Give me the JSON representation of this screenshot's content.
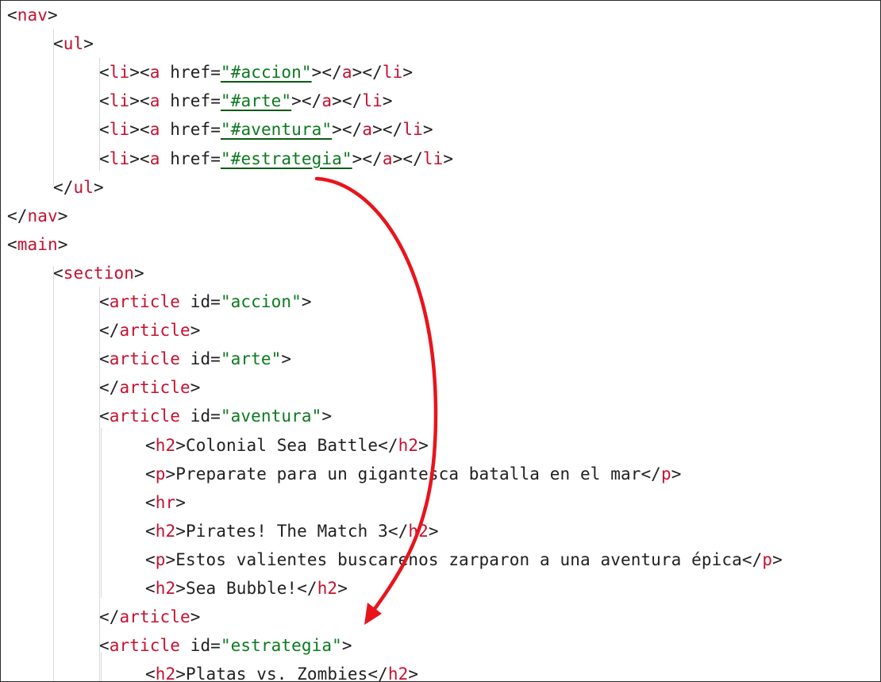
{
  "code": {
    "language": "html",
    "lines": [
      {
        "indent": 0,
        "parts": [
          [
            "p",
            "<"
          ],
          [
            "t",
            "nav"
          ],
          [
            "p",
            ">"
          ]
        ]
      },
      {
        "indent": 1,
        "parts": [
          [
            "p",
            "<"
          ],
          [
            "t",
            "ul"
          ],
          [
            "p",
            ">"
          ]
        ]
      },
      {
        "indent": 2,
        "parts": [
          [
            "p",
            "<"
          ],
          [
            "t",
            "li"
          ],
          [
            "p",
            "><"
          ],
          [
            "t",
            "a"
          ],
          [
            "a",
            " href="
          ],
          [
            "v",
            "\"#accion\"",
            "u"
          ],
          [
            "p",
            "></"
          ],
          [
            "t",
            "a"
          ],
          [
            "p",
            "></"
          ],
          [
            "t",
            "li"
          ],
          [
            "p",
            ">"
          ]
        ]
      },
      {
        "indent": 2,
        "parts": [
          [
            "p",
            "<"
          ],
          [
            "t",
            "li"
          ],
          [
            "p",
            "><"
          ],
          [
            "t",
            "a"
          ],
          [
            "a",
            " href="
          ],
          [
            "v",
            "\"#arte\"",
            "u"
          ],
          [
            "p",
            "></"
          ],
          [
            "t",
            "a"
          ],
          [
            "p",
            "></"
          ],
          [
            "t",
            "li"
          ],
          [
            "p",
            ">"
          ]
        ]
      },
      {
        "indent": 2,
        "parts": [
          [
            "p",
            "<"
          ],
          [
            "t",
            "li"
          ],
          [
            "p",
            "><"
          ],
          [
            "t",
            "a"
          ],
          [
            "a",
            " href="
          ],
          [
            "v",
            "\"#aventura\"",
            "u"
          ],
          [
            "p",
            "></"
          ],
          [
            "t",
            "a"
          ],
          [
            "p",
            "></"
          ],
          [
            "t",
            "li"
          ],
          [
            "p",
            ">"
          ]
        ]
      },
      {
        "indent": 2,
        "parts": [
          [
            "p",
            "<"
          ],
          [
            "t",
            "li"
          ],
          [
            "p",
            "><"
          ],
          [
            "t",
            "a"
          ],
          [
            "a",
            " href="
          ],
          [
            "v",
            "\"#estrategia\"",
            "u"
          ],
          [
            "p",
            "></"
          ],
          [
            "t",
            "a"
          ],
          [
            "p",
            "></"
          ],
          [
            "t",
            "li"
          ],
          [
            "p",
            ">"
          ]
        ]
      },
      {
        "indent": 1,
        "parts": [
          [
            "p",
            "</"
          ],
          [
            "t",
            "ul"
          ],
          [
            "p",
            ">"
          ]
        ]
      },
      {
        "indent": 0,
        "parts": [
          [
            "p",
            "</"
          ],
          [
            "t",
            "nav"
          ],
          [
            "p",
            ">"
          ]
        ]
      },
      {
        "indent": 0,
        "parts": [
          [
            "p",
            "<"
          ],
          [
            "t",
            "main"
          ],
          [
            "p",
            ">"
          ]
        ]
      },
      {
        "indent": 1,
        "parts": [
          [
            "p",
            "<"
          ],
          [
            "t",
            "section"
          ],
          [
            "p",
            ">"
          ]
        ]
      },
      {
        "indent": 2,
        "parts": [
          [
            "p",
            "<"
          ],
          [
            "t",
            "article"
          ],
          [
            "a",
            " id="
          ],
          [
            "v",
            "\"accion\""
          ],
          [
            "p",
            ">"
          ]
        ]
      },
      {
        "indent": 2,
        "parts": [
          [
            "p",
            "</"
          ],
          [
            "t",
            "article"
          ],
          [
            "p",
            ">"
          ]
        ]
      },
      {
        "indent": 2,
        "parts": [
          [
            "p",
            "<"
          ],
          [
            "t",
            "article"
          ],
          [
            "a",
            " id="
          ],
          [
            "v",
            "\"arte\""
          ],
          [
            "p",
            ">"
          ]
        ]
      },
      {
        "indent": 2,
        "parts": [
          [
            "p",
            "</"
          ],
          [
            "t",
            "article"
          ],
          [
            "p",
            ">"
          ]
        ]
      },
      {
        "indent": 2,
        "parts": [
          [
            "p",
            "<"
          ],
          [
            "t",
            "article"
          ],
          [
            "a",
            " id="
          ],
          [
            "v",
            "\"aventura\""
          ],
          [
            "p",
            ">"
          ]
        ]
      },
      {
        "indent": 3,
        "parts": [
          [
            "p",
            "<"
          ],
          [
            "t",
            "h2"
          ],
          [
            "p",
            ">"
          ],
          [
            "x",
            "Colonial Sea Battle"
          ],
          [
            "p",
            "</"
          ],
          [
            "t",
            "h2"
          ],
          [
            "p",
            ">"
          ]
        ]
      },
      {
        "indent": 3,
        "parts": [
          [
            "p",
            "<"
          ],
          [
            "t",
            "p"
          ],
          [
            "p",
            ">"
          ],
          [
            "x",
            "Preparate para un gigantesca batalla en el mar"
          ],
          [
            "p",
            "</"
          ],
          [
            "t",
            "p"
          ],
          [
            "p",
            ">"
          ]
        ]
      },
      {
        "indent": 3,
        "parts": [
          [
            "p",
            "<"
          ],
          [
            "t",
            "hr"
          ],
          [
            "p",
            ">"
          ]
        ]
      },
      {
        "indent": 3,
        "parts": [
          [
            "p",
            "<"
          ],
          [
            "t",
            "h2"
          ],
          [
            "p",
            ">"
          ],
          [
            "x",
            "Pirates! The Match 3"
          ],
          [
            "p",
            "</"
          ],
          [
            "t",
            "h2"
          ],
          [
            "p",
            ">"
          ]
        ]
      },
      {
        "indent": 3,
        "parts": [
          [
            "p",
            "<"
          ],
          [
            "t",
            "p"
          ],
          [
            "p",
            ">"
          ],
          [
            "x",
            "Estos valientes buscarenos zarparon a una aventura épica"
          ],
          [
            "p",
            "</"
          ],
          [
            "t",
            "p"
          ],
          [
            "p",
            ">"
          ]
        ]
      },
      {
        "indent": 3,
        "parts": [
          [
            "p",
            "<"
          ],
          [
            "t",
            "h2"
          ],
          [
            "p",
            ">"
          ],
          [
            "x",
            "Sea Bubble!"
          ],
          [
            "p",
            "</"
          ],
          [
            "t",
            "h2"
          ],
          [
            "p",
            ">"
          ]
        ]
      },
      {
        "indent": 2,
        "parts": [
          [
            "p",
            "</"
          ],
          [
            "t",
            "article"
          ],
          [
            "p",
            ">"
          ]
        ]
      },
      {
        "indent": 2,
        "parts": [
          [
            "p",
            "<"
          ],
          [
            "t",
            "article"
          ],
          [
            "a",
            " id="
          ],
          [
            "v",
            "\"estrategia\""
          ],
          [
            "p",
            ">"
          ]
        ]
      },
      {
        "indent": 3,
        "parts": [
          [
            "p",
            "<"
          ],
          [
            "t",
            "h2"
          ],
          [
            "p",
            ">"
          ],
          [
            "x",
            "Platas vs. Zombies"
          ],
          [
            "p",
            "</"
          ],
          [
            "t",
            "h2"
          ],
          [
            "p",
            ">"
          ]
        ]
      }
    ]
  },
  "colors": {
    "tag": "#c8102e",
    "value": "#0b7a1f",
    "text": "#1f1f1f",
    "arrow": "#e8141c",
    "guide": "#d9d9d9"
  },
  "annotation": {
    "type": "red-curved-arrow",
    "from_line": 6,
    "to_line": 23
  }
}
